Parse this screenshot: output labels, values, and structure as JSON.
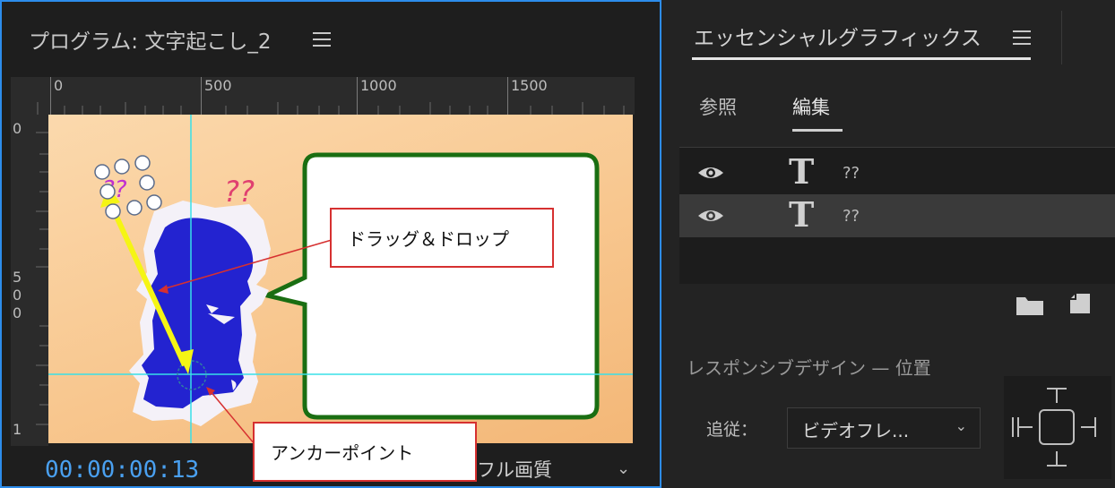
{
  "program_monitor": {
    "title": "プログラム: 文字起こし_2",
    "ruler_h_labels": [
      "0",
      "500",
      "1000",
      "1500"
    ],
    "ruler_v_labels": [
      "0",
      "5",
      "0",
      "0",
      "1"
    ],
    "timecode": "00:00:00:13",
    "quality": "フル画質",
    "canvas_text": "??",
    "callouts": {
      "drag_drop": "ドラッグ＆ドロップ",
      "anchor_point": "アンカーポイント"
    }
  },
  "essential_graphics": {
    "title": "エッセンシャルグラフィックス",
    "tabs": [
      "参照",
      "編集"
    ],
    "active_tab": "編集",
    "layers": [
      {
        "name": "??",
        "selected": false
      },
      {
        "name": "??",
        "selected": true
      }
    ],
    "responsive_title": "レスポンシブデザイン — 位置",
    "follow_label": "追従：",
    "follow_value": "ビデオフレ..."
  },
  "colors": {
    "accent_blue": "#2d8ceb",
    "timecode": "#4aa0f0",
    "callout_border": "#d63030",
    "guide_cyan": "#38e0e8",
    "figure_blue": "#2323d0",
    "bubble_green": "#1a6e12",
    "arrow_yellow": "#f5f514"
  },
  "icons": [
    "hamburger-menu-icon",
    "eye-icon",
    "text-layer-icon",
    "folder-icon",
    "new-item-icon",
    "chevron-down-icon",
    "pin-to-icon"
  ]
}
